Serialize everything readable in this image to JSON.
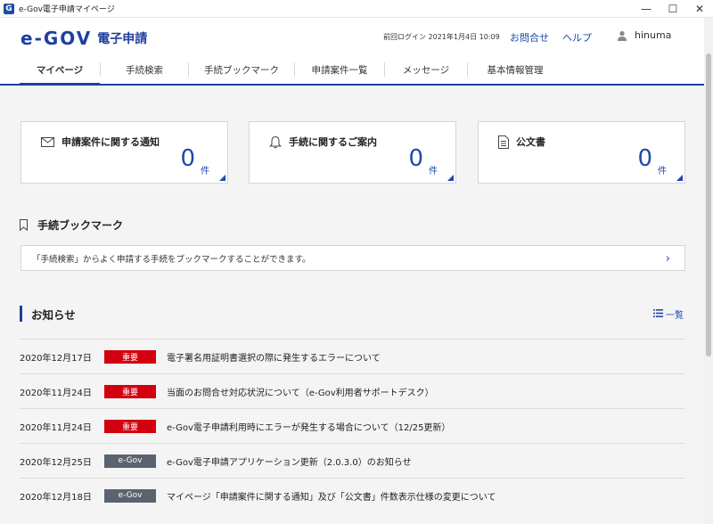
{
  "window": {
    "icon_letter": "G",
    "title": "e-Gov電子申請マイページ",
    "minimize": "—",
    "maximize": "☐",
    "close": "✕"
  },
  "header": {
    "logo_text": "e-GOV",
    "logo_sub": "電子申請",
    "last_login": "前回ログイン 2021年1月4日 10:09",
    "contact_label": "お問合せ",
    "help_label": "ヘルプ",
    "user_name": "hinuma"
  },
  "nav": {
    "tabs": [
      {
        "label": "マイページ",
        "active": true
      },
      {
        "label": "手続検索"
      },
      {
        "label": "手続ブックマーク"
      },
      {
        "label": "申請案件一覧"
      },
      {
        "label": "メッセージ"
      },
      {
        "label": "基本情報管理"
      }
    ]
  },
  "cards": [
    {
      "label": "申請案件に関する通知",
      "count": "0",
      "unit": "件",
      "icon": "mail-icon"
    },
    {
      "label": "手続に関するご案内",
      "count": "0",
      "unit": "件",
      "icon": "bell-icon"
    },
    {
      "label": "公文書",
      "count": "0",
      "unit": "件",
      "icon": "document-icon"
    }
  ],
  "bookmark": {
    "heading": "手続ブックマーク",
    "message": "「手続検索」からよく申請する手続をブックマークすることができます。",
    "chevron": "›"
  },
  "news": {
    "heading": "お知らせ",
    "all_label": "一覧",
    "items": [
      {
        "date": "2020年12月17日",
        "badge": "重要",
        "badge_type": "red",
        "title": "電子署名用証明書選択の際に発生するエラーについて"
      },
      {
        "date": "2020年11月24日",
        "badge": "重要",
        "badge_type": "red",
        "title": "当面のお問合せ対応状況について（e-Gov利用者サポートデスク）"
      },
      {
        "date": "2020年11月24日",
        "badge": "重要",
        "badge_type": "red",
        "title": "e-Gov電子申請利用時にエラーが発生する場合について（12/25更新）"
      },
      {
        "date": "2020年12月25日",
        "badge": "e-Gov",
        "badge_type": "gray",
        "title": "e-Gov電子申請アプリケーション更新（2.0.3.0）のお知らせ"
      },
      {
        "date": "2020年12月18日",
        "badge": "e-Gov",
        "badge_type": "gray",
        "title": "マイページ「申請案件に関する通知」及び「公文書」件数表示仕様の変更について"
      }
    ]
  },
  "colors": {
    "brand": "#1f3f9e",
    "link": "#1f4aa8",
    "important": "#d3000f",
    "egov_badge": "#5b6370"
  }
}
